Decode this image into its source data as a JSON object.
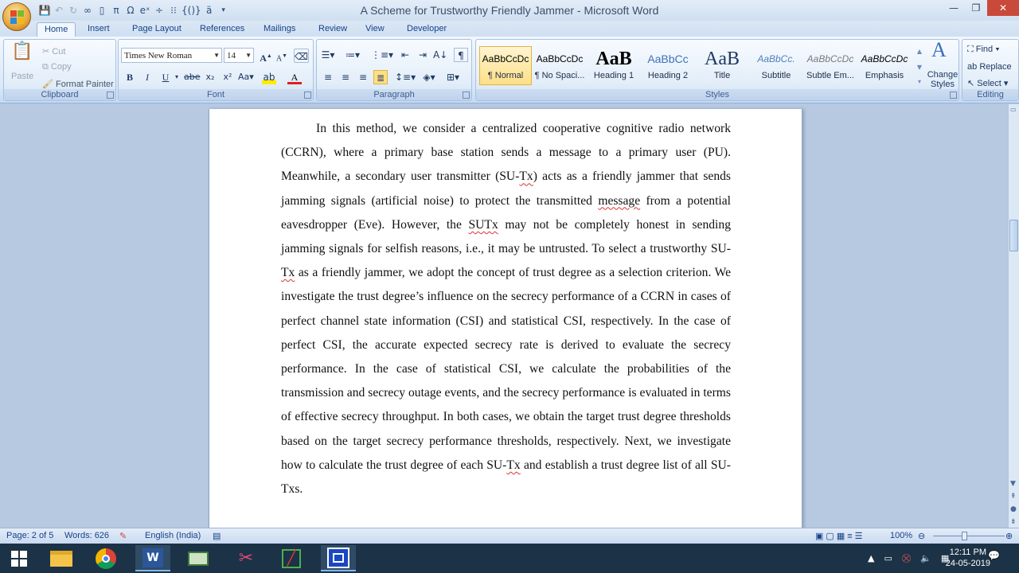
{
  "window": {
    "title": "A Scheme for Trustworthy Friendly Jammer - Microsoft Word"
  },
  "tabs": [
    "Home",
    "Insert",
    "Page Layout",
    "References",
    "Mailings",
    "Review",
    "View",
    "Developer"
  ],
  "clipboard": {
    "paste": "Paste",
    "cut": "Cut",
    "copy": "Copy",
    "format_painter": "Format Painter",
    "group": "Clipboard"
  },
  "font": {
    "name": "Times New Roman",
    "size": "14",
    "group": "Font"
  },
  "paragraph": {
    "group": "Paragraph"
  },
  "styles": {
    "items": [
      {
        "preview": "AaBbCcDc",
        "name": "¶ Normal"
      },
      {
        "preview": "AaBbCcDc",
        "name": "¶ No Spaci..."
      },
      {
        "preview": "AaB",
        "name": "Heading 1"
      },
      {
        "preview": "AaBbCc",
        "name": "Heading 2"
      },
      {
        "preview": "AaB",
        "name": "Title"
      },
      {
        "preview": "AaBbCc.",
        "name": "Subtitle"
      },
      {
        "preview": "AaBbCcDc",
        "name": "Subtle Em..."
      },
      {
        "preview": "AaBbCcDc",
        "name": "Emphasis"
      }
    ],
    "change": "Change Styles",
    "group": "Styles"
  },
  "editing": {
    "find": "Find",
    "replace": "Replace",
    "select": "Select",
    "group": "Editing"
  },
  "document": {
    "p1": "In this method, we consider a centralized cooperative cognitive radio network (CCRN), where a primary base station sends a message to a primary user (PU). Meanwhile, a secondary user transmitter (SU-",
    "w_tx1": "Tx",
    "p2": ") acts as a friendly jammer that sends jamming signals (artificial noise) to protect the transmitted ",
    "w_message": "message",
    "p3": " from a potential eavesdropper (Eve). However, the ",
    "w_sutx": "SUTx",
    "p4": " may not be completely honest in sending jamming signals for selfish reasons, i.e., it may be untrusted. To select a trustworthy SU-",
    "w_tx2": "Tx",
    "p5": " as a friendly jammer, we adopt the concept of trust degree as a selection criterion. We investigate the trust degree’s influence on the secrecy performance of a CCRN in cases of perfect channel state information (CSI) and statistical CSI, respectively. In the case of perfect CSI, the accurate expected secrecy rate is derived to evaluate the secrecy performance. In the case of statistical CSI, we calculate the probabilities of the transmission and secrecy outage events, and the secrecy performance is evaluated in terms of effective secrecy throughput. In both cases, we obtain the target trust degree thresholds based on the target secrecy performance thresholds, respectively. Next, we investigate how to calculate the trust degree of each SU-",
    "w_tx3": "Tx",
    "p6": " and establish a trust degree list of all SU-Txs."
  },
  "status": {
    "page": "Page: 2 of 5",
    "words": "Words: 626",
    "language": "English (India)",
    "zoom": "100%"
  },
  "clock": {
    "time": "12:11 PM",
    "date": "24-05-2019"
  }
}
